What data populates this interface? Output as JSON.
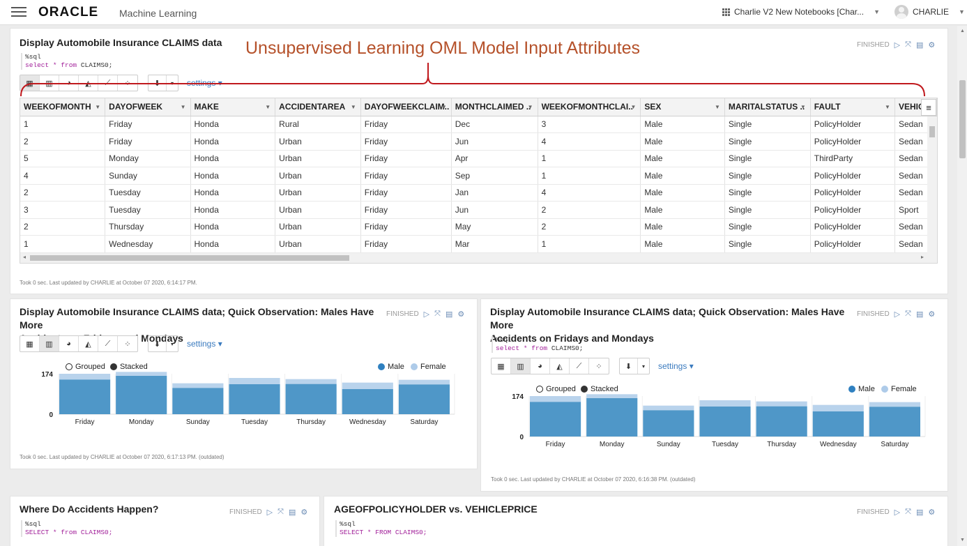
{
  "app": {
    "logo": "ORACLE",
    "product": "Machine Learning",
    "project": "Charlie V2 New Notebooks [Char...",
    "user": "CHARLIE"
  },
  "annotation": "Unsupervised Learning OML Model Input Attributes",
  "status_finished": "FINISHED",
  "settings_label": "settings ▾",
  "p1": {
    "title": "Display Automobile Insurance CLAIMS data",
    "code_line1": "%sql",
    "code_kw": "select * from",
    "code_rest": " CLAIMS0;",
    "footer": "Took 0 sec. Last updated by CHARLIE at October 07 2020, 6:14:17 PM.",
    "columns": [
      "WEEKOFMONTH",
      "DAYOFWEEK",
      "MAKE",
      "ACCIDENTAREA",
      "DAYOFWEEKCLAIM..",
      "MONTHCLAIMED ..",
      "WEEKOFMONTHCLAI..",
      "SEX",
      "MARITALSTATUS ..",
      "FAULT",
      "VEHICLE"
    ],
    "rows": [
      [
        "1",
        "Friday",
        "Honda",
        "Rural",
        "Friday",
        "Dec",
        "3",
        "Male",
        "Single",
        "PolicyHolder",
        "Sedan"
      ],
      [
        "2",
        "Friday",
        "Honda",
        "Urban",
        "Friday",
        "Jun",
        "4",
        "Male",
        "Single",
        "PolicyHolder",
        "Sedan"
      ],
      [
        "5",
        "Monday",
        "Honda",
        "Urban",
        "Friday",
        "Apr",
        "1",
        "Male",
        "Single",
        "ThirdParty",
        "Sedan"
      ],
      [
        "4",
        "Sunday",
        "Honda",
        "Urban",
        "Friday",
        "Sep",
        "1",
        "Male",
        "Single",
        "PolicyHolder",
        "Sedan"
      ],
      [
        "2",
        "Tuesday",
        "Honda",
        "Urban",
        "Friday",
        "Jan",
        "4",
        "Male",
        "Single",
        "PolicyHolder",
        "Sedan"
      ],
      [
        "3",
        "Tuesday",
        "Honda",
        "Urban",
        "Friday",
        "Jun",
        "2",
        "Male",
        "Single",
        "PolicyHolder",
        "Sport"
      ],
      [
        "2",
        "Thursday",
        "Honda",
        "Urban",
        "Friday",
        "May",
        "2",
        "Male",
        "Single",
        "PolicyHolder",
        "Sedan"
      ],
      [
        "1",
        "Wednesday",
        "Honda",
        "Urban",
        "Friday",
        "Mar",
        "1",
        "Male",
        "Single",
        "PolicyHolder",
        "Sedan"
      ]
    ]
  },
  "p2": {
    "title_line1": "Display Automobile Insurance CLAIMS data; Quick Observation: Males Have More",
    "title_line2": "Accidents on Fridays and Mondays",
    "footer": "Took 0 sec. Last updated by CHARLIE at October 07 2020, 6:17:13 PM. (outdated)",
    "legend": {
      "grouped": "Grouped",
      "stacked": "Stacked"
    }
  },
  "p3": {
    "title_line1": "Display Automobile Insurance CLAIMS data; Quick Observation: Males Have More",
    "title_line2": "Accidents on Fridays and Mondays",
    "code_line1": "%sql",
    "code_kw": "select * from",
    "code_rest": " CLAIMS0;",
    "footer": "Took 0 sec. Last updated by CHARLIE at October 07 2020, 6:16:38 PM. (outdated)",
    "legend": {
      "grouped": "Grouped",
      "stacked": "Stacked"
    }
  },
  "p4": {
    "title": "Where Do Accidents Happen?",
    "code_line1": "%sql",
    "code_line2": "SELECT * from CLAIMS0;"
  },
  "p5": {
    "title": "AGEOFPOLICYHOLDER vs. VEHICLEPRICE",
    "code_line1": "%sql",
    "code_line2": "SELECT * FROM CLAIMS0;"
  },
  "colors": {
    "male": "#4f97c8",
    "female": "#b9d3ec",
    "accent": "#3b7bbf"
  },
  "chart_data": [
    {
      "type": "bar",
      "stacked": true,
      "categories": [
        "Friday",
        "Monday",
        "Sunday",
        "Tuesday",
        "Thursday",
        "Wednesday",
        "Saturday"
      ],
      "series": [
        {
          "name": "Male",
          "values": [
            149,
            165,
            113,
            129,
            130,
            108,
            128
          ]
        },
        {
          "name": "Female",
          "values": [
            25,
            17,
            20,
            27,
            21,
            28,
            20
          ]
        }
      ],
      "ylim": [
        0,
        174
      ],
      "yticks": [
        "174",
        "0"
      ]
    },
    {
      "type": "bar",
      "stacked": true,
      "categories": [
        "Friday",
        "Monday",
        "Sunday",
        "Tuesday",
        "Thursday",
        "Wednesday",
        "Saturday"
      ],
      "series": [
        {
          "name": "Male",
          "values": [
            149,
            165,
            113,
            129,
            130,
            108,
            128
          ]
        },
        {
          "name": "Female",
          "values": [
            25,
            17,
            20,
            27,
            21,
            28,
            20
          ]
        }
      ],
      "ylim": [
        0,
        174
      ],
      "yticks": [
        "174",
        "0"
      ]
    }
  ]
}
